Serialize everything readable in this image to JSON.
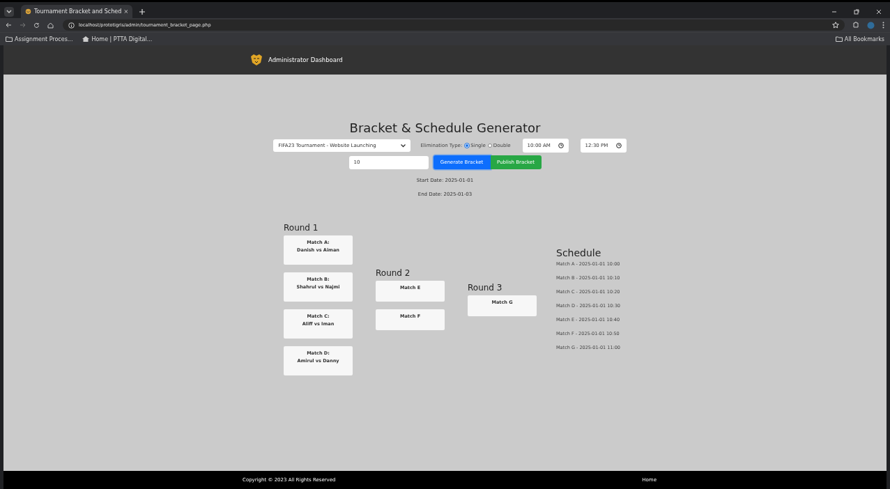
{
  "browser": {
    "tab_title": "Tournament Bracket and Sched",
    "url": "localhost/prototigris/admin/tournament_bracket_page.php",
    "bookmarks": [
      {
        "label": "Assignment Proces...",
        "kind": "folder"
      },
      {
        "label": "Home | PTTA Digital...",
        "kind": "page"
      }
    ],
    "all_bookmarks": "All Bookmarks"
  },
  "header": {
    "title": "Administrator Dashboard"
  },
  "page": {
    "title": "Bracket & Schedule Generator",
    "tournament_select": {
      "value": "FIFA23 Tournament - Website Launching"
    },
    "elimination": {
      "label": "Elimination Type:",
      "options": [
        {
          "label": "Single",
          "selected": true
        },
        {
          "label": "Double",
          "selected": false
        }
      ]
    },
    "start_time": {
      "value": "10:00 AM"
    },
    "end_time": {
      "value": "12:30 PM"
    },
    "interval_input": {
      "value": "10"
    },
    "buttons": [
      {
        "label": "Generate Bracket",
        "kind": "primary"
      },
      {
        "label": "Publish Bracket",
        "kind": "success"
      }
    ],
    "start_date": "Start Date: 2025-01-01",
    "end_date": "End Date: 2025-01-03",
    "rounds": [
      {
        "title": "Round 1",
        "matches": [
          {
            "label": "Match A:",
            "players": "Danish vs Aiman"
          },
          {
            "label": "Match B:",
            "players": "Shahrul vs Najmi"
          },
          {
            "label": "Match C:",
            "players": "Aliff vs Iman"
          },
          {
            "label": "Match D:",
            "players": "Amirul vs Danny"
          }
        ]
      },
      {
        "title": "Round 2",
        "matches": [
          {
            "label": "Match E"
          },
          {
            "label": "Match F"
          }
        ]
      },
      {
        "title": "Round 3",
        "matches": [
          {
            "label": "Match G"
          }
        ]
      }
    ],
    "schedule": {
      "title": "Schedule",
      "items": [
        "Match A - 2025-01-01 10:00",
        "Match B - 2025-01-01 10:10",
        "Match C - 2025-01-01 10:20",
        "Match D - 2025-01-01 10:30",
        "Match E - 2025-01-01 10:40",
        "Match F - 2025-01-01 10:50",
        "Match G - 2025-01-01 11:00"
      ]
    }
  },
  "footer": {
    "copyright": "Copyright © 2023 All Rights Reserved",
    "link": "Home"
  }
}
